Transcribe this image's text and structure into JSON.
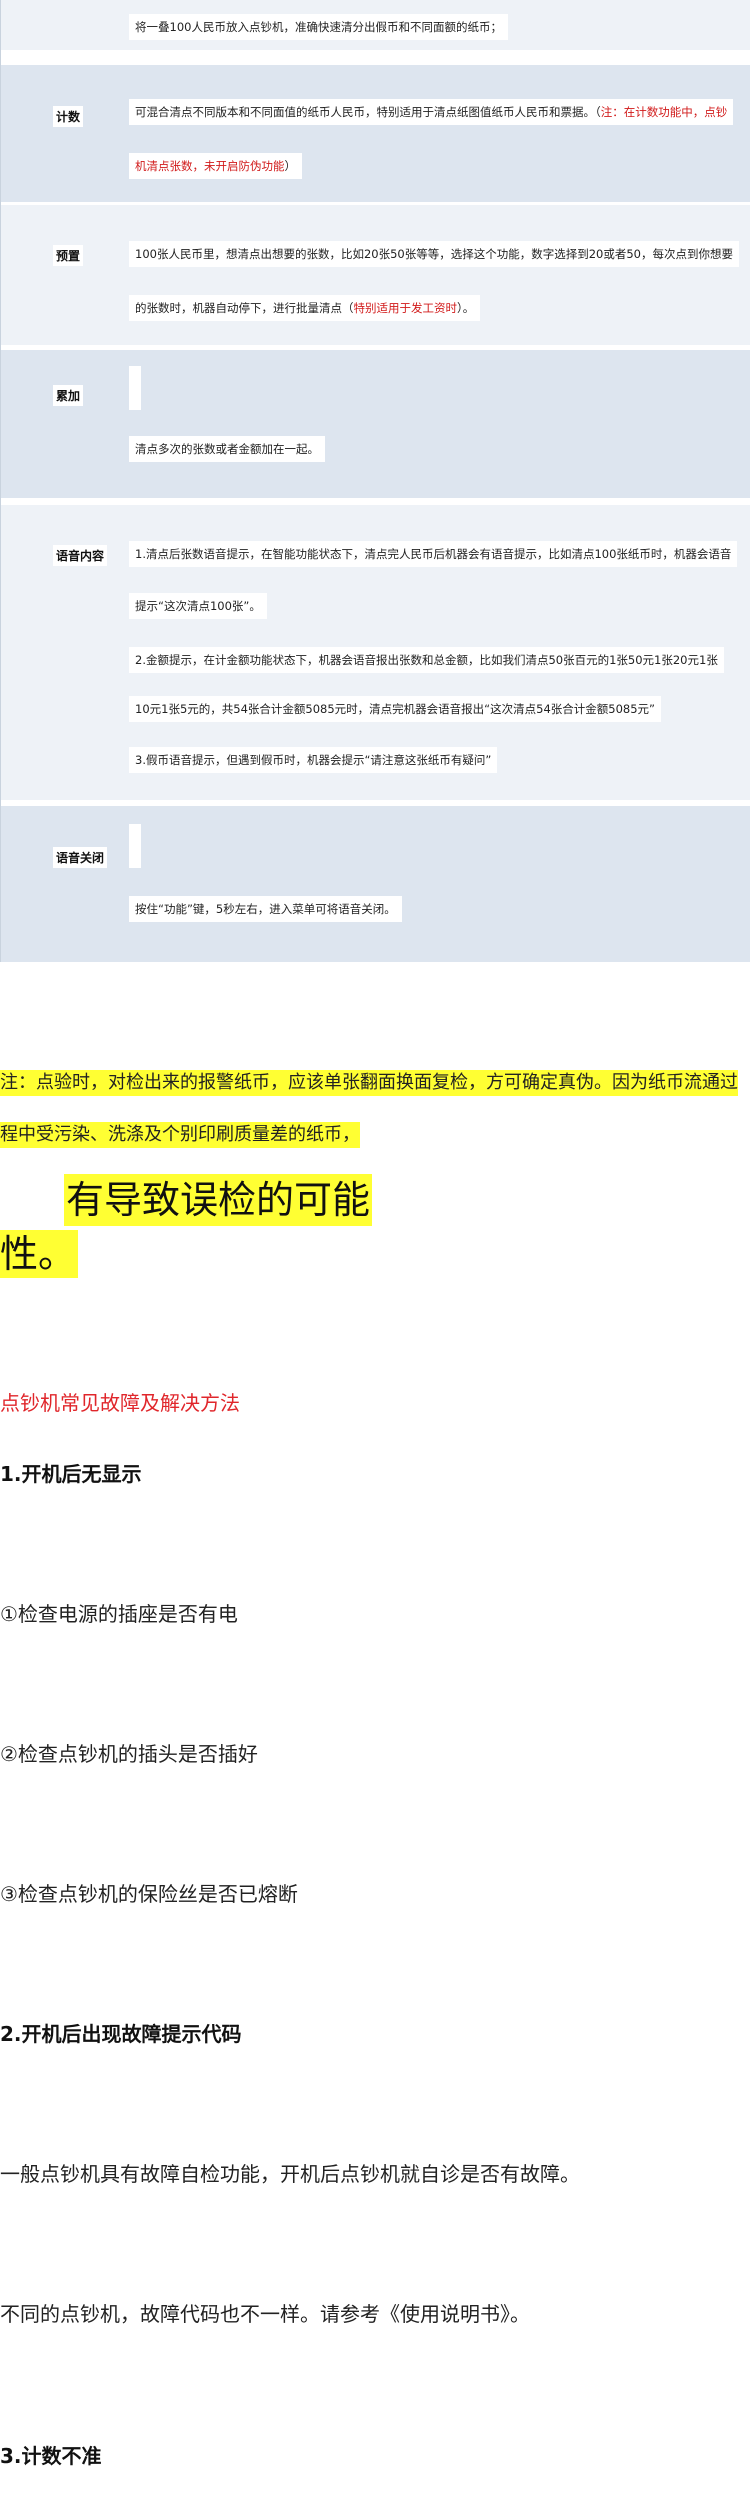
{
  "table": {
    "rows": [
      {
        "label": "",
        "text": "将一叠100人民币放入点钞机，准确快速清分出假币和不同面额的纸币；"
      },
      {
        "label": "计数",
        "line1": "可混合清点不同版本和不同面值的纸币人民币，特别适用于清点纸图值纸币人民币和票据。（",
        "line1_red": "注：在计数功能中，点钞",
        "line2_red": "机清点张数，未开启防伪功能",
        "line2_end": "）"
      },
      {
        "label": "预置",
        "line1": "100张人民币里，想清点出想要的张数，比如20张50张等等，选择这个功能，数字选择到20或者50，每次点到你想要",
        "line2": "的张数时，机器自动停下，进行批量清点（",
        "line2_red": "特别适用于发工资时",
        "line2_end": "）。"
      },
      {
        "label": "累加",
        "text": "清点多次的张数或者金额加在一起。"
      },
      {
        "label": "语音内容",
        "l1": "1.清点后张数语音提示，在智能功能状态下，清点完人民币后机器会有语音提示，比如清点100张纸币时，机器会语音",
        "l2": "提示“这次清点100张”。",
        "l3": "2.金额提示，在计金额功能状态下，机器会语音报出张数和总金额，比如我们清点50张百元的1张50元1张20元1张",
        "l4": "10元1张5元的，共54张合计金额5085元时，清点完机器会语音报出“这次清点54张合计金额5085元”",
        "l5": "3.假币语音提示，但遇到假币时，机器会提示“请注意这张纸币有疑问”"
      },
      {
        "label": "语音关闭",
        "text": "按住“功能”键，5秒左右，进入菜单可将语音关闭。"
      }
    ]
  },
  "note": {
    "line1": "注：点验时，对检出来的报警纸币，应该单张翻面换面复检，方可确定真伪。因为纸币流通过",
    "line2": "程中受污染、洗涤及个别印刷质量差的纸币，",
    "big1": "有导致误检的可能",
    "big2": "性。"
  },
  "section_title": "点钞机常见故障及解决方法",
  "items": {
    "h1": "1.开机后无显示",
    "p1": "①检查电源的插座是否有电",
    "p2": "②检查点钞机的插头是否插好",
    "p3": "③检查点钞机的保险丝是否已熔断",
    "h2": "2.开机后出现故障提示代码",
    "p4": "一般点钞机具有故障自检功能，开机后点钞机就自诊是否有故障。",
    "p5": "不同的点钞机，故障代码也不一样。请参考《使用说明书》。",
    "h3": "3.计数不准"
  },
  "colors": {
    "highlight": "#ffff33",
    "red": "#e0262b",
    "table_bg": "#dde5ef"
  }
}
